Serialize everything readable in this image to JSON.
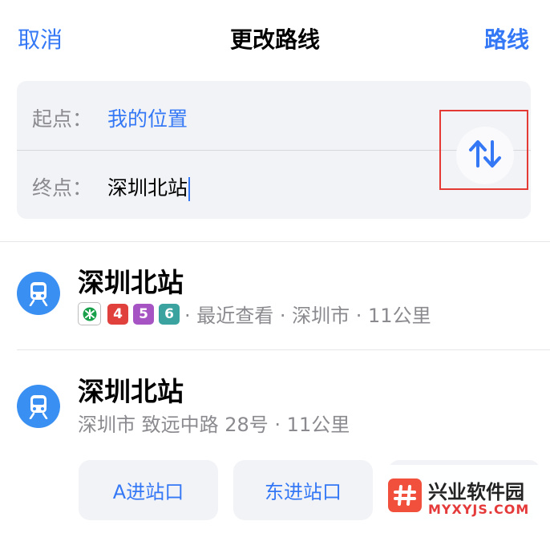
{
  "header": {
    "cancel_label": "取消",
    "title": "更改路线",
    "route_label": "路线"
  },
  "route": {
    "start_label": "起点：",
    "start_value": "我的位置",
    "end_label": "终点：",
    "end_value": "深圳北站",
    "swap_icon": "swap-vertical-arrows-icon"
  },
  "results": [
    {
      "title": "深圳北站",
      "icon": "train-icon",
      "lines": [
        {
          "label": "4",
          "color": "#e0413d"
        },
        {
          "label": "5",
          "color": "#a653c4"
        },
        {
          "label": "6",
          "color": "#3aa3a0"
        }
      ],
      "subtitle": "· 最近查看 · 深圳市 · 11公里"
    },
    {
      "title": "深圳北站",
      "icon": "train-icon",
      "subtitle": "深圳市 致远中路 28号 · 11公里"
    }
  ],
  "exits": [
    "A进站口",
    "东进站口"
  ],
  "watermark": {
    "name": "兴业软件园",
    "url": "MYXYJS.COM"
  },
  "colors": {
    "accent": "#3478f6",
    "icon_bg": "#3a8ff3",
    "highlight": "#e53935"
  }
}
